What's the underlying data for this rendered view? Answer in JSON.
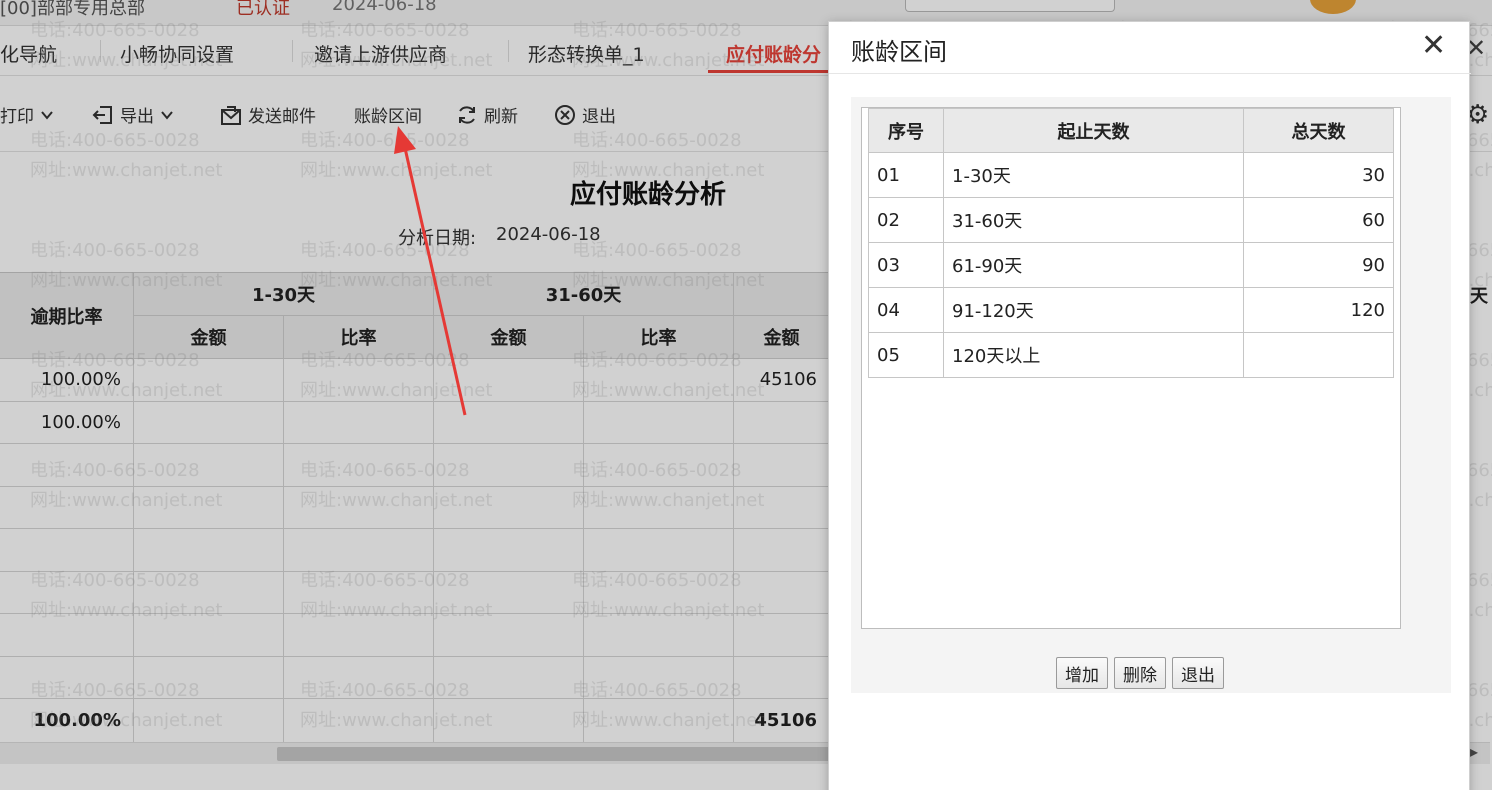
{
  "topbar": {
    "company": "[00]部部专用总部",
    "status": "已认证",
    "date": "2024-06-18"
  },
  "tabs": [
    {
      "label": "化导航"
    },
    {
      "label": "小畅协同设置"
    },
    {
      "label": "邀请上游供应商"
    },
    {
      "label": "形态转换单_1"
    },
    {
      "label": "应付账龄分"
    }
  ],
  "toolbar": {
    "print_label": "打印",
    "export_label": "导出",
    "email_label": "发送邮件",
    "aging_interval_label": "账龄区间",
    "refresh_label": "刷新",
    "exit_label": "退出"
  },
  "report": {
    "title": "应付账龄分析",
    "date_label": "分析日期:",
    "date_value": "2024-06-18"
  },
  "grid": {
    "overdue_header": "逾期比率",
    "group_1": "1-30天",
    "group_2": "31-60天",
    "amount": "金额",
    "ratio": "比率",
    "right_fragment": "天",
    "rows": [
      {
        "overdue": "100.00%",
        "amount3": "45106"
      },
      {
        "overdue": "100.00%",
        "amount3": ""
      },
      {
        "overdue": "",
        "amount3": ""
      },
      {
        "overdue": "",
        "amount3": ""
      },
      {
        "overdue": "",
        "amount3": ""
      },
      {
        "overdue": "",
        "amount3": ""
      },
      {
        "overdue": "",
        "amount3": ""
      },
      {
        "overdue": "",
        "amount3": ""
      }
    ],
    "total": {
      "overdue": "100.00%",
      "amount3": "45106"
    }
  },
  "watermark": {
    "phone": "电话:400-665-0028",
    "site": "网址:www.chanjet.net"
  },
  "modal": {
    "title": "账龄区间",
    "columns": {
      "seq": "序号",
      "range": "起止天数",
      "total": "总天数"
    },
    "rows": [
      {
        "seq": "01",
        "range": "1-30天",
        "total": "30"
      },
      {
        "seq": "02",
        "range": "31-60天",
        "total": "60"
      },
      {
        "seq": "03",
        "range": "61-90天",
        "total": "90"
      },
      {
        "seq": "04",
        "range": "91-120天",
        "total": "120"
      },
      {
        "seq": "05",
        "range": "120天以上",
        "total": ""
      }
    ],
    "buttons": {
      "add": "增加",
      "delete": "删除",
      "exit": "退出"
    }
  },
  "colors": {
    "accent": "#e8433a",
    "annotation_arrow": "#e53935"
  },
  "icons": [
    "chevron-down-icon",
    "export-icon",
    "mail-icon",
    "refresh-icon",
    "close-circle-icon",
    "gear-icon",
    "close-icon"
  ]
}
